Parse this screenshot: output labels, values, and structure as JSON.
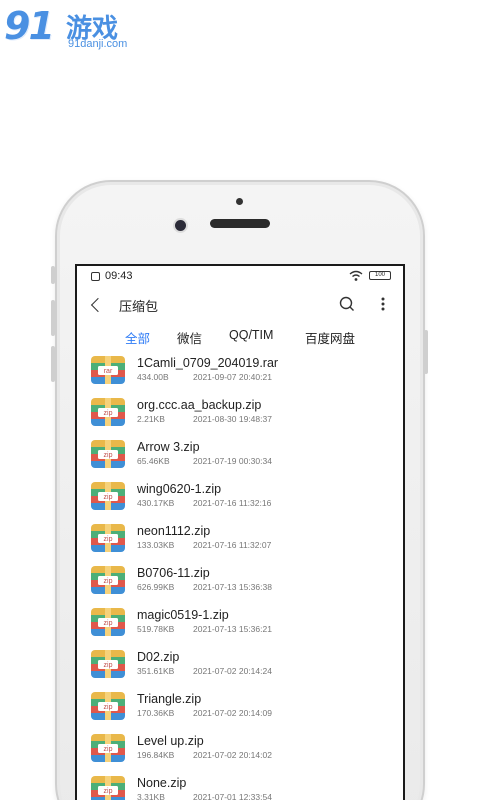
{
  "watermark": {
    "logo_text": "91",
    "logo_cn": "游戏",
    "logo_url": "91danji.com"
  },
  "status_bar": {
    "time": "09:43",
    "battery": "100"
  },
  "app_bar": {
    "title": "压缩包",
    "back_icon": "back-chevron-icon",
    "search_icon": "search-icon",
    "more_icon": "more-vertical-icon"
  },
  "tabs": [
    {
      "label": "全部",
      "active": true
    },
    {
      "label": "微信",
      "active": false
    },
    {
      "label": "QQ/TIM",
      "active": false
    },
    {
      "label": "百度网盘",
      "active": false
    }
  ],
  "accent_color": "#2f7cf6",
  "files": [
    {
      "name": "1Camli_0709_204019.rar",
      "size": "434.00B",
      "date": "2021-09-07 20:40:21",
      "type": "rar"
    },
    {
      "name": "org.ccc.aa_backup.zip",
      "size": "2.21KB",
      "date": "2021-08-30 19:48:37",
      "type": "zip"
    },
    {
      "name": "Arrow 3.zip",
      "size": "65.46KB",
      "date": "2021-07-19 00:30:34",
      "type": "zip"
    },
    {
      "name": "wing0620-1.zip",
      "size": "430.17KB",
      "date": "2021-07-16 11:32:16",
      "type": "zip"
    },
    {
      "name": "neon1112.zip",
      "size": "133.03KB",
      "date": "2021-07-16 11:32:07",
      "type": "zip"
    },
    {
      "name": "B0706-11.zip",
      "size": "626.99KB",
      "date": "2021-07-13 15:36:38",
      "type": "zip"
    },
    {
      "name": "magic0519-1.zip",
      "size": "519.78KB",
      "date": "2021-07-13 15:36:21",
      "type": "zip"
    },
    {
      "name": "D02.zip",
      "size": "351.61KB",
      "date": "2021-07-02 20:14:24",
      "type": "zip"
    },
    {
      "name": "Triangle.zip",
      "size": "170.36KB",
      "date": "2021-07-02 20:14:09",
      "type": "zip"
    },
    {
      "name": "Level up.zip",
      "size": "196.84KB",
      "date": "2021-07-02 20:14:02",
      "type": "zip"
    },
    {
      "name": "None.zip",
      "size": "3.31KB",
      "date": "2021-07-01 12:33:54",
      "type": "zip"
    }
  ]
}
